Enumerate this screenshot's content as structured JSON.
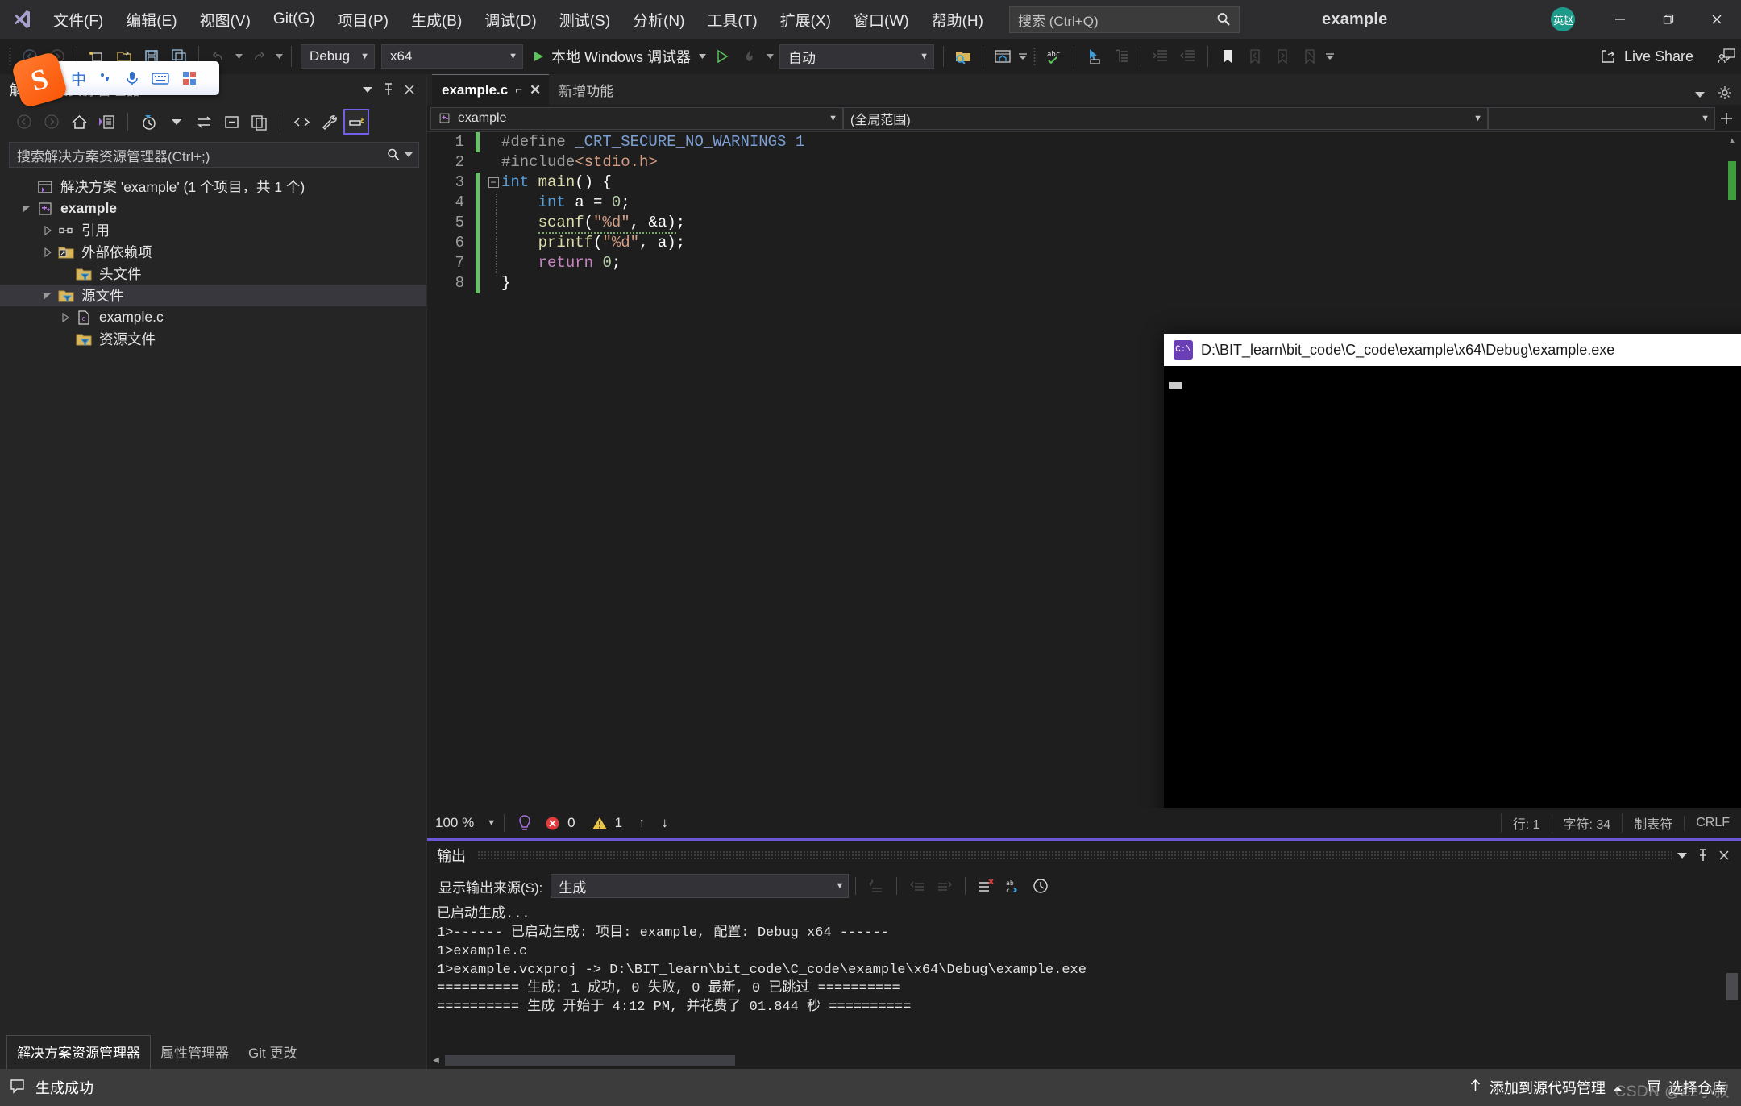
{
  "window": {
    "app_title": "example",
    "avatar_initials": "英赵",
    "minimize": "—",
    "restore": "❐",
    "close": "✕"
  },
  "menu": {
    "items": [
      {
        "label": "文件(F)",
        "name": "menu-file"
      },
      {
        "label": "编辑(E)",
        "name": "menu-edit"
      },
      {
        "label": "视图(V)",
        "name": "menu-view"
      },
      {
        "label": "Git(G)",
        "name": "menu-git"
      },
      {
        "label": "项目(P)",
        "name": "menu-project"
      },
      {
        "label": "生成(B)",
        "name": "menu-build"
      },
      {
        "label": "调试(D)",
        "name": "menu-debug"
      },
      {
        "label": "测试(S)",
        "name": "menu-test"
      },
      {
        "label": "分析(N)",
        "name": "menu-analyze"
      },
      {
        "label": "工具(T)",
        "name": "menu-tools"
      },
      {
        "label": "扩展(X)",
        "name": "menu-extensions"
      },
      {
        "label": "窗口(W)",
        "name": "menu-window"
      },
      {
        "label": "帮助(H)",
        "name": "menu-help"
      }
    ],
    "search_placeholder": "搜索 (Ctrl+Q)"
  },
  "toolbar": {
    "config": "Debug",
    "platform": "x64",
    "run_label": "本地 Windows 调试器",
    "auto": "自动",
    "live_share": "Live Share"
  },
  "ime": {
    "logo": "S",
    "items": [
      "中",
      "°,",
      "mic",
      "keyboard",
      "apps"
    ]
  },
  "solution_explorer": {
    "title": "解决方案资源管理器",
    "search_placeholder": "搜索解决方案资源管理器(Ctrl+;)",
    "tree": [
      {
        "label": "解决方案 'example' (1 个项目，共 1 个)",
        "indent": 0,
        "icon": "solution",
        "twisty": "none",
        "bold": false,
        "selected": false
      },
      {
        "label": "example",
        "indent": 1,
        "icon": "cpp-project",
        "twisty": "open",
        "bold": true,
        "selected": false
      },
      {
        "label": "引用",
        "indent": 2,
        "icon": "references",
        "twisty": "closed",
        "bold": false,
        "selected": false
      },
      {
        "label": "外部依赖项",
        "indent": 2,
        "icon": "folder-ext",
        "twisty": "closed",
        "bold": false,
        "selected": false
      },
      {
        "label": "头文件",
        "indent": 2,
        "icon": "filter-folder",
        "twisty": "none",
        "bold": false,
        "selected": false
      },
      {
        "label": "源文件",
        "indent": 2,
        "icon": "filter-folder",
        "twisty": "open",
        "bold": false,
        "selected": true
      },
      {
        "label": "example.c",
        "indent": 3,
        "icon": "c-file",
        "twisty": "closed",
        "bold": false,
        "selected": false
      },
      {
        "label": "资源文件",
        "indent": 2,
        "icon": "filter-folder",
        "twisty": "none",
        "bold": false,
        "selected": false
      }
    ],
    "bottom_tabs": [
      {
        "label": "解决方案资源管理器",
        "active": true
      },
      {
        "label": "属性管理器",
        "active": false
      },
      {
        "label": "Git 更改",
        "active": false
      }
    ]
  },
  "editor": {
    "tabs": [
      {
        "label": "example.c",
        "active": true,
        "pin": "⌐",
        "close": "✕"
      },
      {
        "label": "新增功能",
        "active": false
      }
    ],
    "nav_project": "example",
    "nav_scope": "(全局范围)",
    "nav_member": "",
    "lines": [
      {
        "n": "1",
        "changed": true,
        "fold": "none",
        "guide": false,
        "tokens": [
          {
            "t": "#define ",
            "c": "k-pp"
          },
          {
            "t": "_CRT_SECURE_NO_WARNINGS ",
            "c": "k-ppid"
          },
          {
            "t": "1",
            "c": "k-ppid"
          }
        ]
      },
      {
        "n": "2",
        "changed": false,
        "fold": "none",
        "guide": false,
        "tokens": [
          {
            "t": "#include",
            "c": "k-pp"
          },
          {
            "t": "<stdio.h>",
            "c": "k-inc"
          }
        ]
      },
      {
        "n": "3",
        "changed": true,
        "fold": "minus",
        "guide": false,
        "tokens": [
          {
            "t": "int",
            "c": "k-kw"
          },
          {
            "t": " ",
            "c": "k-pl"
          },
          {
            "t": "main",
            "c": "k-fn"
          },
          {
            "t": "() {",
            "c": "k-pl"
          }
        ]
      },
      {
        "n": "4",
        "changed": true,
        "fold": "none",
        "guide": true,
        "tokens": [
          {
            "t": "    ",
            "c": "k-pl"
          },
          {
            "t": "int",
            "c": "k-kw"
          },
          {
            "t": " a = ",
            "c": "k-pl"
          },
          {
            "t": "0",
            "c": "k-num"
          },
          {
            "t": ";",
            "c": "k-pl"
          }
        ]
      },
      {
        "n": "5",
        "changed": true,
        "fold": "none",
        "guide": true,
        "tokens": [
          {
            "t": "    ",
            "c": "k-pl"
          },
          {
            "t": "scanf",
            "c": "k-fn squig"
          },
          {
            "t": "(",
            "c": "k-pl squig"
          },
          {
            "t": "\"%d\"",
            "c": "k-str squig"
          },
          {
            "t": ", &a)",
            "c": "k-pl squig"
          },
          {
            "t": ";",
            "c": "k-pl"
          }
        ]
      },
      {
        "n": "6",
        "changed": true,
        "fold": "none",
        "guide": true,
        "tokens": [
          {
            "t": "    ",
            "c": "k-pl"
          },
          {
            "t": "printf",
            "c": "k-fn"
          },
          {
            "t": "(",
            "c": "k-pl"
          },
          {
            "t": "\"%d\"",
            "c": "k-str"
          },
          {
            "t": ", a);",
            "c": "k-pl"
          }
        ]
      },
      {
        "n": "7",
        "changed": true,
        "fold": "none",
        "guide": true,
        "tokens": [
          {
            "t": "    ",
            "c": "k-pl"
          },
          {
            "t": "return",
            "c": "k-ctl"
          },
          {
            "t": " ",
            "c": "k-pl"
          },
          {
            "t": "0",
            "c": "k-num"
          },
          {
            "t": ";",
            "c": "k-pl"
          }
        ]
      },
      {
        "n": "8",
        "changed": true,
        "fold": "none",
        "guide": false,
        "tokens": [
          {
            "t": "}",
            "c": "k-pl"
          }
        ]
      }
    ],
    "status": {
      "zoom": "100 %",
      "errors": "0",
      "warnings": "1",
      "up": "↑",
      "down": "↓",
      "line": "行: 1",
      "char": "字符: 34",
      "tab": "制表符",
      "eol": "CRLF"
    }
  },
  "console": {
    "title": "D:\\BIT_learn\\bit_code\\C_code\\example\\x64\\Debug\\example.exe",
    "icon_text": "C:\\",
    "body": ""
  },
  "output": {
    "title": "输出",
    "source_label": "显示输出来源(S):",
    "source_value": "生成",
    "lines": [
      "已启动生成...",
      "1>------ 已启动生成: 项目: example, 配置: Debug x64 ------",
      "1>example.c",
      "1>example.vcxproj -> D:\\BIT_learn\\bit_code\\C_code\\example\\x64\\Debug\\example.exe",
      "========== 生成: 1 成功, 0 失败, 0 最新, 0 已跳过 ==========",
      "========== 生成 开始于 4:12 PM, 并花费了 01.844 秒 =========="
    ]
  },
  "statusbar": {
    "build_status": "生成成功",
    "add_to_source_control": "添加到源代码管理",
    "select_repo": "选择仓库",
    "watermark": "CSDN @Zz小叔"
  },
  "colors": {
    "accent_purple": "#6b57d6",
    "change_green": "#67c167",
    "error_red": "#e03c3c",
    "warning_yellow": "#e8c547",
    "avatar_teal": "#1e9a8a",
    "ime_orange": "#fb5607"
  }
}
